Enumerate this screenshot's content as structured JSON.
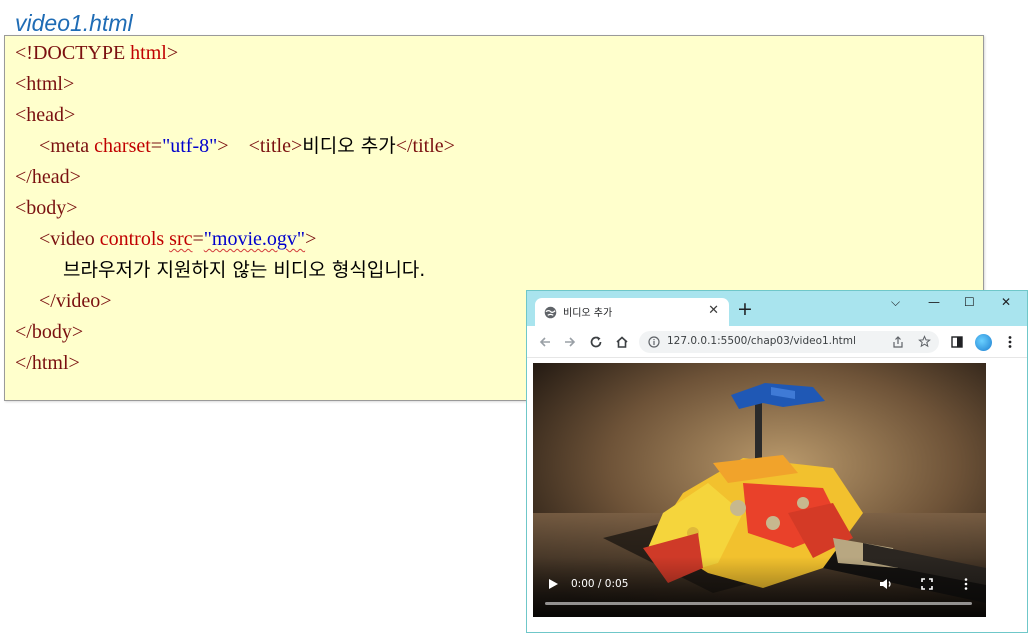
{
  "file_title": "video1.html",
  "code": {
    "l1_tag": "<!DOCTYPE",
    "l1_attr": " html",
    "l1_end": ">",
    "l2": "<html>",
    "l3": "<head>",
    "l4_open": "<meta",
    "l4_attr": " charset",
    "l4_eq": "=",
    "l4_val": "\"utf-8\"",
    "l4_close": ">",
    "l4_title_open": "<title>",
    "l4_title_text": "비디오 추가",
    "l4_title_close": "</title>",
    "l5": "</head>",
    "l6": "<body>",
    "l7_open": "<video",
    "l7_attr1": " controls",
    "l7_attr2": "src",
    "l7_eq": "=",
    "l7_val": "\"movie.ogv\"",
    "l7_close": ">",
    "l8_text": "브라우저가 지원하지 않는 비디오 형식입니다.",
    "l9": "</video>",
    "l10": "</body>",
    "l11": "</html>"
  },
  "browser": {
    "tab_title": "비디오 추가",
    "tab_close": "✕",
    "new_tab": "+",
    "win_dropdown": "⌵",
    "win_minimize": "—",
    "win_maximize": "☐",
    "win_close": "✕",
    "url": "127.0.0.1:5500/chap03/video1.html"
  },
  "video": {
    "time": "0:00 / 0:05",
    "progress": 0.0
  },
  "colors": {
    "tab_strip": "#a9e4ee",
    "code_bg": "#ffffcc",
    "tag": "#7a1010",
    "attr": "#c00000",
    "value": "#0000cc"
  }
}
